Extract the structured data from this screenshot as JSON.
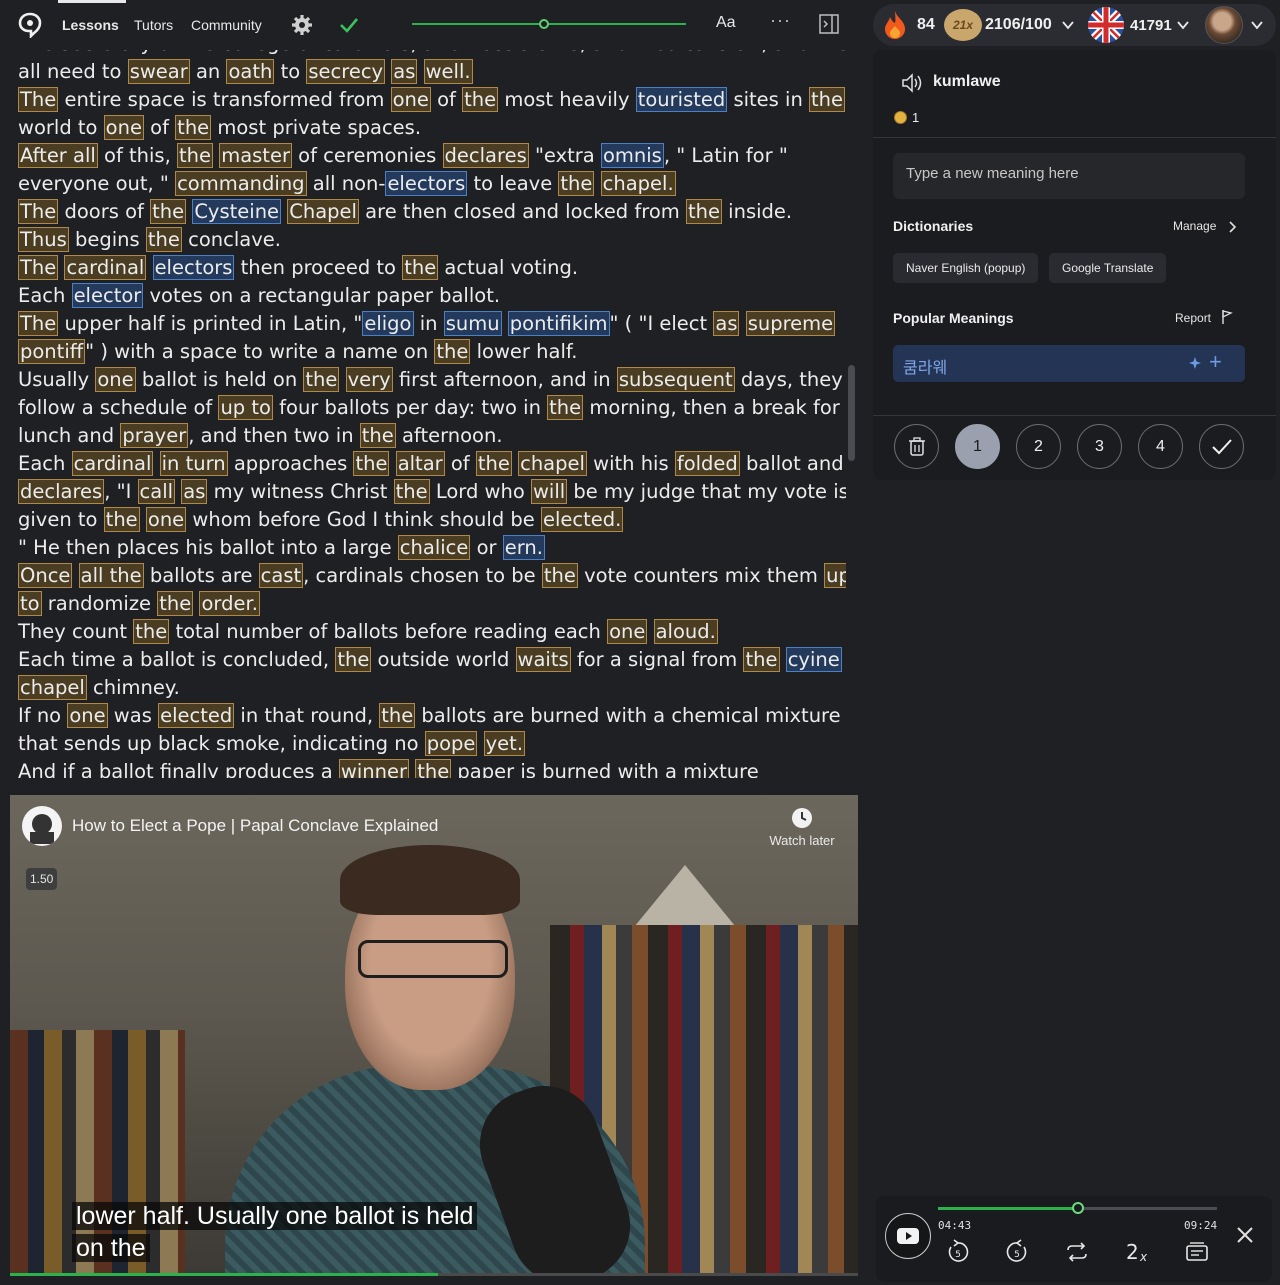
{
  "nav": {
    "lessons": "Lessons",
    "tutors": "Tutors",
    "community": "Community",
    "font_button": "Aa",
    "more_button": "···",
    "lesson_progress": 0.48
  },
  "stats": {
    "streak": "84",
    "multiplier": "21x",
    "daily_goal": "2106/100",
    "known_words": "41791",
    "language": "English"
  },
  "reader": {
    "lines": [
      [
        [
          "The secretary of the college of cardinals, a few assistants, and medical staff, and they",
          ""
        ]
      ],
      [
        [
          "all need to ",
          ""
        ],
        [
          "swear",
          "y"
        ],
        [
          " an ",
          ""
        ],
        [
          "oath",
          "y"
        ],
        [
          " to ",
          ""
        ],
        [
          "secrecy",
          "y"
        ],
        [
          " ",
          ""
        ],
        [
          "as",
          "y"
        ],
        [
          " ",
          ""
        ],
        [
          "well.",
          "y"
        ]
      ],
      [
        [
          "The",
          "y"
        ],
        [
          " entire space is transformed from ",
          ""
        ],
        [
          "one",
          "y"
        ],
        [
          " of ",
          ""
        ],
        [
          "the",
          "y"
        ],
        [
          " most heavily ",
          ""
        ],
        [
          "touristed",
          "b"
        ],
        [
          " sites in ",
          ""
        ],
        [
          "the",
          "y"
        ]
      ],
      [
        [
          "world to ",
          ""
        ],
        [
          "one",
          "y"
        ],
        [
          " of ",
          ""
        ],
        [
          "the",
          "y"
        ],
        [
          " most private spaces.",
          ""
        ]
      ],
      [
        [
          "After all",
          "y"
        ],
        [
          " of this, ",
          ""
        ],
        [
          "the",
          "y"
        ],
        [
          " ",
          ""
        ],
        [
          "master",
          "y"
        ],
        [
          " of ceremonies ",
          ""
        ],
        [
          "declares",
          "y"
        ],
        [
          " \"extra ",
          ""
        ],
        [
          "omnis",
          "b"
        ],
        [
          ", \" Latin for \"",
          ""
        ]
      ],
      [
        [
          "everyone out, \" ",
          ""
        ],
        [
          "commanding",
          "y"
        ],
        [
          " all non-",
          ""
        ],
        [
          "electors",
          "b"
        ],
        [
          " to leave ",
          ""
        ],
        [
          "the",
          "y"
        ],
        [
          " ",
          ""
        ],
        [
          "chapel.",
          "y"
        ]
      ],
      [
        [
          "The",
          "y"
        ],
        [
          " doors of ",
          ""
        ],
        [
          "the",
          "y"
        ],
        [
          " ",
          ""
        ],
        [
          "Cysteine",
          "b"
        ],
        [
          " ",
          ""
        ],
        [
          "Chapel",
          "y"
        ],
        [
          " are then closed and locked from ",
          ""
        ],
        [
          "the",
          "y"
        ],
        [
          " inside.",
          ""
        ]
      ],
      [
        [
          "Thus",
          "y"
        ],
        [
          " begins ",
          ""
        ],
        [
          "the",
          "y"
        ],
        [
          " conclave.",
          ""
        ]
      ],
      [
        [
          "The",
          "y"
        ],
        [
          " ",
          ""
        ],
        [
          "cardinal",
          "y"
        ],
        [
          " ",
          ""
        ],
        [
          "electors",
          "b"
        ],
        [
          " then proceed to ",
          ""
        ],
        [
          "the",
          "y"
        ],
        [
          " actual voting.",
          ""
        ]
      ],
      [
        [
          "Each ",
          ""
        ],
        [
          "elector",
          "b"
        ],
        [
          " votes on a rectangular paper ballot.",
          ""
        ]
      ],
      [
        [
          "The",
          "y"
        ],
        [
          " upper half is printed in Latin, \"",
          ""
        ],
        [
          "eligo",
          "b"
        ],
        [
          " in ",
          ""
        ],
        [
          "sumu",
          "b"
        ],
        [
          " ",
          ""
        ],
        [
          "pontifikim",
          "b"
        ],
        [
          "\" ( \"I elect ",
          ""
        ],
        [
          "as",
          "y"
        ],
        [
          " ",
          ""
        ],
        [
          "supreme",
          "y"
        ]
      ],
      [
        [
          "pontiff",
          "y"
        ],
        [
          "\" ) with a space to write a name on ",
          ""
        ],
        [
          "the",
          "y"
        ],
        [
          " lower half.",
          ""
        ]
      ],
      [
        [
          "Usually ",
          ""
        ],
        [
          "one",
          "y"
        ],
        [
          " ballot is held on ",
          ""
        ],
        [
          "the",
          "y"
        ],
        [
          " ",
          ""
        ],
        [
          "very",
          "y"
        ],
        [
          " first afternoon, and in ",
          ""
        ],
        [
          "subsequent",
          "y"
        ],
        [
          " days, they",
          ""
        ]
      ],
      [
        [
          "follow a schedule of ",
          ""
        ],
        [
          "up to",
          "y"
        ],
        [
          " four ballots per day: two in ",
          ""
        ],
        [
          "the",
          "y"
        ],
        [
          " morning, then a break for",
          ""
        ]
      ],
      [
        [
          "lunch and ",
          ""
        ],
        [
          "prayer",
          "y"
        ],
        [
          ", and then two in ",
          ""
        ],
        [
          "the",
          "y"
        ],
        [
          " afternoon.",
          ""
        ]
      ],
      [
        [
          "Each ",
          ""
        ],
        [
          "cardinal",
          "y"
        ],
        [
          " ",
          ""
        ],
        [
          "in turn",
          "y"
        ],
        [
          " approaches ",
          ""
        ],
        [
          "the",
          "y"
        ],
        [
          " ",
          ""
        ],
        [
          "altar",
          "y"
        ],
        [
          " of ",
          ""
        ],
        [
          "the",
          "y"
        ],
        [
          " ",
          ""
        ],
        [
          "chapel",
          "y"
        ],
        [
          " with his ",
          ""
        ],
        [
          "folded",
          "y"
        ],
        [
          " ballot and",
          ""
        ]
      ],
      [
        [
          "declares",
          "y"
        ],
        [
          ", \"I ",
          ""
        ],
        [
          "call",
          "y"
        ],
        [
          " ",
          ""
        ],
        [
          "as",
          "y"
        ],
        [
          " my witness Christ ",
          ""
        ],
        [
          "the",
          "y"
        ],
        [
          " Lord who ",
          ""
        ],
        [
          "will",
          "y"
        ],
        [
          " be my judge that my vote is",
          ""
        ]
      ],
      [
        [
          "given to ",
          ""
        ],
        [
          "the",
          "y"
        ],
        [
          " ",
          ""
        ],
        [
          "one",
          "y"
        ],
        [
          " whom before God I think should be ",
          ""
        ],
        [
          "elected.",
          "y"
        ]
      ],
      [
        [
          "\" He then places his ballot into a large ",
          ""
        ],
        [
          "chalice",
          "y"
        ],
        [
          " or ",
          ""
        ],
        [
          "ern.",
          "b"
        ]
      ],
      [
        [
          "Once",
          "y"
        ],
        [
          " ",
          ""
        ],
        [
          "all the",
          "y"
        ],
        [
          " ballots are ",
          ""
        ],
        [
          "cast",
          "y"
        ],
        [
          ", cardinals chosen to be ",
          ""
        ],
        [
          "the",
          "y"
        ],
        [
          " vote counters mix them ",
          ""
        ],
        [
          "up",
          "y"
        ]
      ],
      [
        [
          "to",
          "y"
        ],
        [
          " randomize ",
          ""
        ],
        [
          "the",
          "y"
        ],
        [
          " ",
          ""
        ],
        [
          "order.",
          "y"
        ]
      ],
      [
        [
          "They count ",
          ""
        ],
        [
          "the",
          "y"
        ],
        [
          " total number of ballots before reading each ",
          ""
        ],
        [
          "one",
          "y"
        ],
        [
          " ",
          ""
        ],
        [
          "aloud.",
          "y"
        ]
      ],
      [
        [
          "Each time a ballot is concluded, ",
          ""
        ],
        [
          "the",
          "y"
        ],
        [
          " outside world ",
          ""
        ],
        [
          "waits",
          "y"
        ],
        [
          " for a signal from ",
          ""
        ],
        [
          "the",
          "y"
        ],
        [
          " ",
          ""
        ],
        [
          "cyine",
          "b"
        ]
      ],
      [
        [
          "chapel",
          "y"
        ],
        [
          " chimney.",
          ""
        ]
      ],
      [
        [
          "If no ",
          ""
        ],
        [
          "one",
          "y"
        ],
        [
          " was ",
          ""
        ],
        [
          "elected",
          "y"
        ],
        [
          " in that round, ",
          ""
        ],
        [
          "the",
          "y"
        ],
        [
          " ballots are burned with a chemical mixture",
          ""
        ]
      ],
      [
        [
          "that sends up black smoke, indicating no ",
          ""
        ],
        [
          "pope",
          "y"
        ],
        [
          " ",
          ""
        ],
        [
          "yet.",
          "y"
        ]
      ],
      [
        [
          "And if a ballot finally produces a ",
          ""
        ],
        [
          "winner",
          "y"
        ],
        [
          " ",
          ""
        ],
        [
          "the",
          "y"
        ],
        [
          " paper is burned with a mixture",
          ""
        ]
      ]
    ]
  },
  "video": {
    "title": "How to Elect a Pope | Papal Conclave Explained",
    "watch_later": "Watch later",
    "speed": "1.50",
    "subtitle_line1": "lower half. Usually one ballot is held",
    "subtitle_line2": "on the",
    "progress": 0.505
  },
  "side": {
    "word": "kumlawe",
    "coins": "1",
    "meaning_placeholder": "Type a new meaning here",
    "dictionaries_title": "Dictionaries",
    "manage_label": "Manage",
    "dictionaries": [
      "Naver English (popup)",
      "Google Translate"
    ],
    "popular_title": "Popular Meanings",
    "report_label": "Report",
    "popular_meaning": "쿰라웨",
    "status_levels": [
      "1",
      "2",
      "3",
      "4"
    ]
  },
  "player": {
    "current_time": "04:43",
    "total_time": "09:24",
    "progress": 0.5
  },
  "colors": {
    "highlight_known_bg": "#4a3d22",
    "highlight_known_border": "#b0894a",
    "highlight_new_bg": "#243a5c",
    "highlight_new_border": "#4d7fc4",
    "accent_green": "#2bb24c"
  }
}
